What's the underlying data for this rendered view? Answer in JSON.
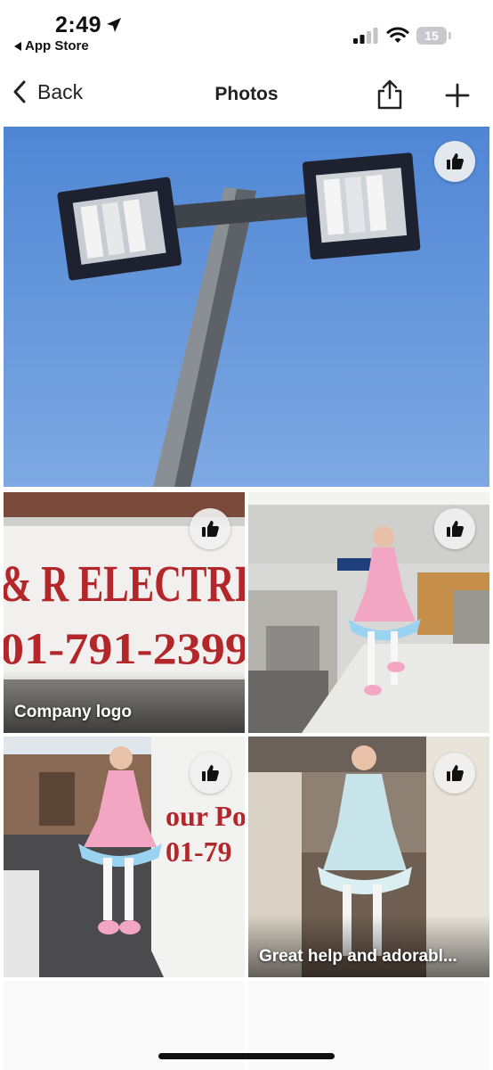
{
  "status_bar": {
    "time": "2:49",
    "back_app_label": "App Store",
    "battery_level": "15",
    "icons": [
      "location-arrow-icon",
      "cellular-signal-icon",
      "wifi-icon",
      "battery-icon"
    ]
  },
  "nav": {
    "back_label": "Back",
    "title": "Photos",
    "icons": [
      "chevron-left-icon",
      "share-icon",
      "plus-icon"
    ]
  },
  "photos": [
    {
      "subject": "street light pole against blue sky",
      "caption": ""
    },
    {
      "subject": "electric company van lettering",
      "caption": "Company logo",
      "van_text_line1": "& R ELECTRI",
      "van_text_line2": "01-791-2399"
    },
    {
      "subject": "person in pink ruffled dress in store aisle",
      "caption": ""
    },
    {
      "subject": "person in pink ruffled dress in parking lot next to van",
      "caption": "",
      "van_text_line1": "our Po",
      "van_text_line2": "01-79"
    },
    {
      "subject": "person in light blue ruffled dress in unfinished room",
      "caption": "Great help and adorabl..."
    }
  ],
  "colors": {
    "sky": "#5d8fd6",
    "van_red": "#b3262a",
    "like_button_bg": "#f0f0f0"
  }
}
